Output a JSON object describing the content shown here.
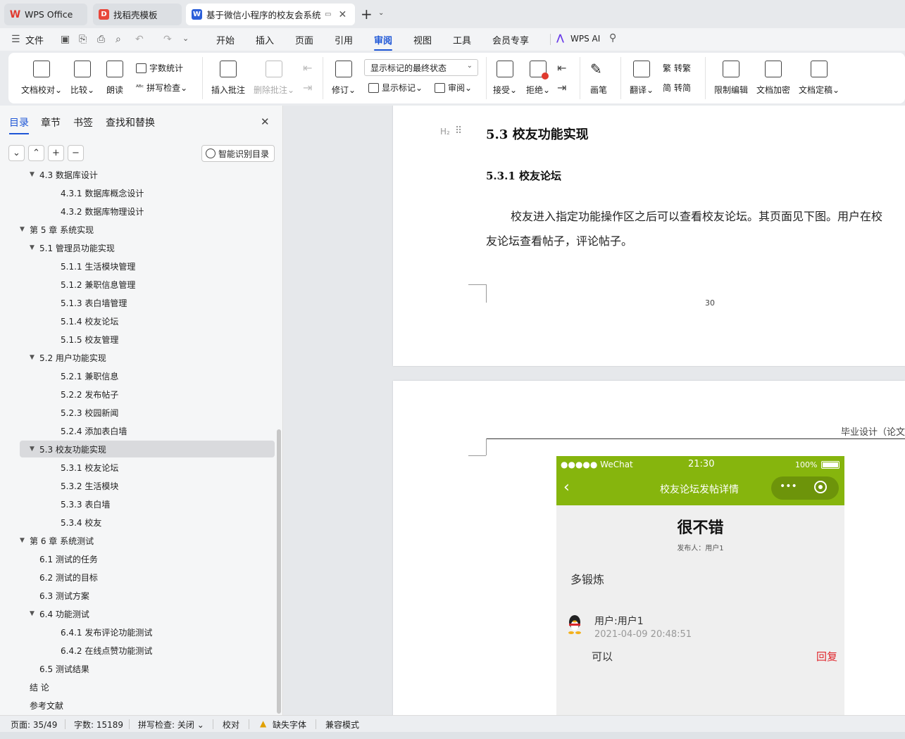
{
  "tabs": [
    {
      "label": "WPS Office",
      "icon": "wps-logo-icon",
      "color": "#e03a2f"
    },
    {
      "label": "找稻壳模板",
      "icon": "docer-icon",
      "color": "#e8473b"
    },
    {
      "label": "基于微信小程序的校友会系统设",
      "icon": "word-doc-icon",
      "color": "#2b5fd9"
    }
  ],
  "menu": {
    "file": "文件",
    "items": [
      "开始",
      "插入",
      "页面",
      "引用",
      "审阅",
      "视图",
      "工具",
      "会员专享"
    ],
    "active": "审阅",
    "ai": "WPS AI"
  },
  "ribbon": {
    "doc_check": "文档校对",
    "compare": "比较",
    "read_aloud": "朗读",
    "word_count": "字数统计",
    "spell_check": "拼写检查",
    "insert_comment": "插入批注",
    "delete_comment": "删除批注",
    "revise": "修订",
    "markup_dropdown": "显示标记的最终状态",
    "show_markup": "显示标记",
    "review": "审阅",
    "accept": "接受",
    "reject": "拒绝",
    "pen": "画笔",
    "translate": "翻译",
    "to_traditional": "转繁",
    "to_simplified": "转简",
    "restrict_edit": "限制编辑",
    "encrypt": "文档加密",
    "finalize": "文档定稿"
  },
  "nav": {
    "tabs": [
      "目录",
      "章节",
      "书签",
      "查找和替换"
    ],
    "active_tab": "目录",
    "smart_btn": "智能识别目录",
    "items": [
      {
        "text": "4.3  数据库设计",
        "level": 2,
        "exp": true
      },
      {
        "text": "4.3.1  数据库概念设计",
        "level": 3
      },
      {
        "text": "4.3.2  数据库物理设计",
        "level": 3
      },
      {
        "text": "第 5 章  系统实现",
        "level": 1,
        "exp": true
      },
      {
        "text": "5.1  管理员功能实现",
        "level": 2,
        "exp": true
      },
      {
        "text": "5.1.1  生活模块管理",
        "level": 3
      },
      {
        "text": "5.1.2  兼职信息管理",
        "level": 3
      },
      {
        "text": "5.1.3  表白墙管理",
        "level": 3
      },
      {
        "text": "5.1.4  校友论坛",
        "level": 3
      },
      {
        "text": "5.1.5  校友管理",
        "level": 3
      },
      {
        "text": "5.2  用户功能实现",
        "level": 2,
        "exp": true
      },
      {
        "text": "5.2.1  兼职信息",
        "level": 3
      },
      {
        "text": "5.2.2  发布帖子",
        "level": 3
      },
      {
        "text": "5.2.3  校园新闻",
        "level": 3
      },
      {
        "text": "5.2.4  添加表白墙",
        "level": 3
      },
      {
        "text": "5.3  校友功能实现",
        "level": 2,
        "exp": true,
        "sel": true
      },
      {
        "text": "5.3.1  校友论坛",
        "level": 3
      },
      {
        "text": "5.3.2  生活模块",
        "level": 3
      },
      {
        "text": "5.3.3  表白墙",
        "level": 3
      },
      {
        "text": "5.3.4  校友",
        "level": 3
      },
      {
        "text": "第 6 章  系统测试",
        "level": 1,
        "exp": true
      },
      {
        "text": "6.1  测试的任务",
        "level": 2
      },
      {
        "text": "6.2  测试的目标",
        "level": 2
      },
      {
        "text": "6.3  测试方案",
        "level": 2
      },
      {
        "text": "6.4  功能测试",
        "level": 2,
        "exp": true
      },
      {
        "text": "6.4.1  发布评论功能测试",
        "level": 3
      },
      {
        "text": "6.4.2  在线点赞功能测试",
        "level": 3
      },
      {
        "text": "6.5  测试结果",
        "level": 2
      },
      {
        "text": "结    论",
        "level": 1
      },
      {
        "text": "参考文献",
        "level": 1
      }
    ]
  },
  "doc": {
    "h2_marker": "H₂",
    "heading": "5.3  校友功能实现",
    "subheading": "5.3.1  校友论坛",
    "para_line1": "校友进入指定功能操作区之后可以查看校友论坛。其页面见下图。用户在校",
    "para_line2": "友论坛查看帖子，评论帖子。",
    "page_number": "30",
    "header_text": "毕业设计（论文）"
  },
  "phone": {
    "carrier": "●●●●● WeChat",
    "time": "21:30",
    "battery": "100%",
    "title": "校友论坛发帖详情",
    "post_title": "很不错",
    "publisher": "发布人：用户1",
    "content": "多锻炼",
    "comment_user": "用户:用户1",
    "comment_time": "2021-04-09 20:48:51",
    "comment_text": "可以",
    "reply": "回复",
    "header_color": "#86b50d",
    "reply_color": "#e0272d"
  },
  "status": {
    "page": "页面: 35/49",
    "words": "字数: 15189",
    "spell": "拼写检查: 关闭",
    "proof": "校对",
    "missing_font": "缺失字体",
    "compat": "兼容模式"
  }
}
